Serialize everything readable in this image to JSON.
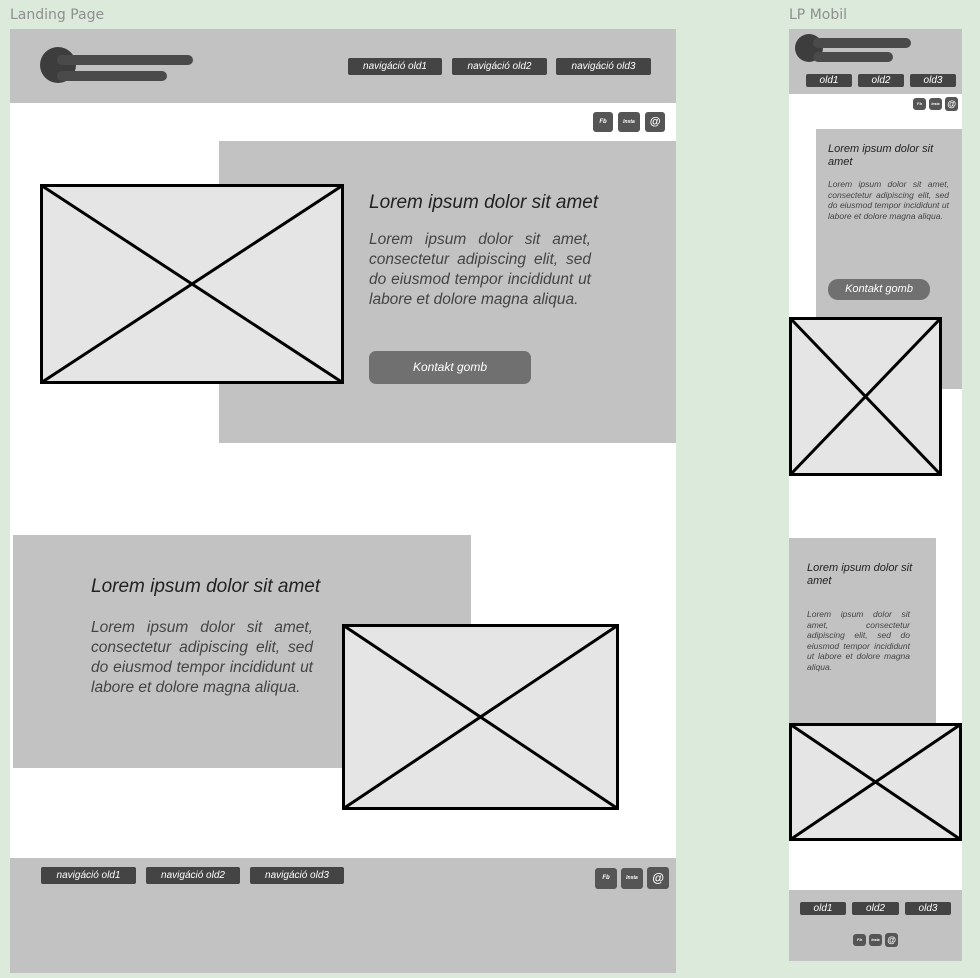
{
  "desktop": {
    "frame_label": "Landing Page",
    "nav": [
      "navigáció old1",
      "navigáció old2",
      "navigáció old3"
    ],
    "social": [
      "Fb",
      "Insta",
      "@"
    ],
    "hero": {
      "title": "Lorem ipsum dolor sit amet",
      "body": "Lorem ipsum dolor sit amet, consectetur adipiscing elit, sed do eiusmod tempor incididunt ut labore et dolore magna aliqua.",
      "button": "Kontakt gomb"
    },
    "section2": {
      "title": "Lorem ipsum dolor sit amet",
      "body": "Lorem ipsum dolor sit amet, consectetur adipiscing elit, sed do eiusmod tempor incididunt ut labore et dolore magna aliqua."
    },
    "footer_nav": [
      "navigáció old1",
      "navigáció old2",
      "navigáció old3"
    ],
    "footer_social": [
      "Fb",
      "Insta",
      "@"
    ]
  },
  "mobile": {
    "frame_label": "LP Mobil",
    "nav": [
      "old1",
      "old2",
      "old3"
    ],
    "social": [
      "Fb",
      "Insta",
      "@"
    ],
    "hero": {
      "title": "Lorem ipsum dolor sit amet",
      "body": "Lorem ipsum dolor sit amet, consectetur adipiscing elit, sed do eiusmod tempor incididunt ut labore et dolore magna aliqua.",
      "button": "Kontakt gomb"
    },
    "section2": {
      "title": "Lorem ipsum dolor sit amet",
      "body": "Lorem ipsum dolor sit amet, consectetur adipiscing elit, sed do eiusmod tempor incididunt ut labore et dolore magna aliqua."
    },
    "footer_nav": [
      "old1",
      "old2",
      "old3"
    ],
    "footer_social": [
      "Fb",
      "Insta",
      "@"
    ]
  }
}
